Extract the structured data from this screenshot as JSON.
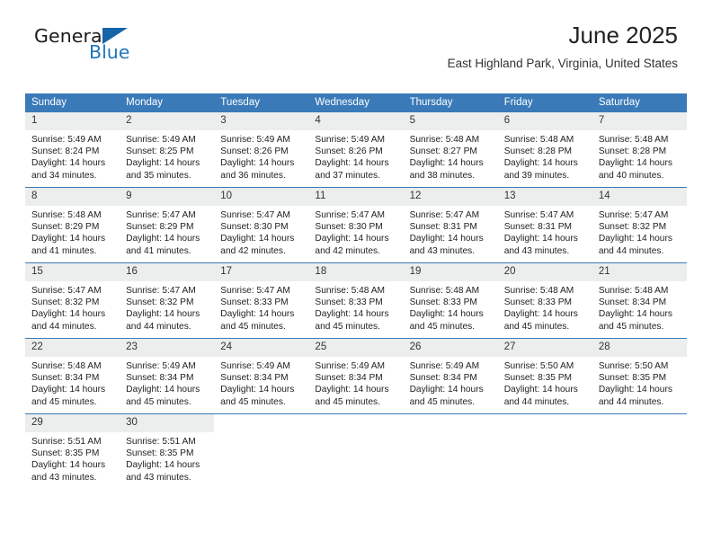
{
  "brand": {
    "word_one": "General",
    "word_two": "Blue",
    "flag_icon": "triangle-flag-icon",
    "blue_hex": "#1f77bd",
    "dark_blue_hex": "#1565a8"
  },
  "header": {
    "title": "June 2025",
    "location": "East Highland Park, Virginia, United States"
  },
  "calendar": {
    "header_bg_hex": "#3a7ab8",
    "daynum_bg_hex": "#eceded",
    "weekdays": [
      "Sunday",
      "Monday",
      "Tuesday",
      "Wednesday",
      "Thursday",
      "Friday",
      "Saturday"
    ],
    "weeks": [
      [
        {
          "day": "1",
          "sunrise": "Sunrise: 5:49 AM",
          "sunset": "Sunset: 8:24 PM",
          "daylight_line1": "Daylight: 14 hours",
          "daylight_line2": "and 34 minutes."
        },
        {
          "day": "2",
          "sunrise": "Sunrise: 5:49 AM",
          "sunset": "Sunset: 8:25 PM",
          "daylight_line1": "Daylight: 14 hours",
          "daylight_line2": "and 35 minutes."
        },
        {
          "day": "3",
          "sunrise": "Sunrise: 5:49 AM",
          "sunset": "Sunset: 8:26 PM",
          "daylight_line1": "Daylight: 14 hours",
          "daylight_line2": "and 36 minutes."
        },
        {
          "day": "4",
          "sunrise": "Sunrise: 5:49 AM",
          "sunset": "Sunset: 8:26 PM",
          "daylight_line1": "Daylight: 14 hours",
          "daylight_line2": "and 37 minutes."
        },
        {
          "day": "5",
          "sunrise": "Sunrise: 5:48 AM",
          "sunset": "Sunset: 8:27 PM",
          "daylight_line1": "Daylight: 14 hours",
          "daylight_line2": "and 38 minutes."
        },
        {
          "day": "6",
          "sunrise": "Sunrise: 5:48 AM",
          "sunset": "Sunset: 8:28 PM",
          "daylight_line1": "Daylight: 14 hours",
          "daylight_line2": "and 39 minutes."
        },
        {
          "day": "7",
          "sunrise": "Sunrise: 5:48 AM",
          "sunset": "Sunset: 8:28 PM",
          "daylight_line1": "Daylight: 14 hours",
          "daylight_line2": "and 40 minutes."
        }
      ],
      [
        {
          "day": "8",
          "sunrise": "Sunrise: 5:48 AM",
          "sunset": "Sunset: 8:29 PM",
          "daylight_line1": "Daylight: 14 hours",
          "daylight_line2": "and 41 minutes."
        },
        {
          "day": "9",
          "sunrise": "Sunrise: 5:47 AM",
          "sunset": "Sunset: 8:29 PM",
          "daylight_line1": "Daylight: 14 hours",
          "daylight_line2": "and 41 minutes."
        },
        {
          "day": "10",
          "sunrise": "Sunrise: 5:47 AM",
          "sunset": "Sunset: 8:30 PM",
          "daylight_line1": "Daylight: 14 hours",
          "daylight_line2": "and 42 minutes."
        },
        {
          "day": "11",
          "sunrise": "Sunrise: 5:47 AM",
          "sunset": "Sunset: 8:30 PM",
          "daylight_line1": "Daylight: 14 hours",
          "daylight_line2": "and 42 minutes."
        },
        {
          "day": "12",
          "sunrise": "Sunrise: 5:47 AM",
          "sunset": "Sunset: 8:31 PM",
          "daylight_line1": "Daylight: 14 hours",
          "daylight_line2": "and 43 minutes."
        },
        {
          "day": "13",
          "sunrise": "Sunrise: 5:47 AM",
          "sunset": "Sunset: 8:31 PM",
          "daylight_line1": "Daylight: 14 hours",
          "daylight_line2": "and 43 minutes."
        },
        {
          "day": "14",
          "sunrise": "Sunrise: 5:47 AM",
          "sunset": "Sunset: 8:32 PM",
          "daylight_line1": "Daylight: 14 hours",
          "daylight_line2": "and 44 minutes."
        }
      ],
      [
        {
          "day": "15",
          "sunrise": "Sunrise: 5:47 AM",
          "sunset": "Sunset: 8:32 PM",
          "daylight_line1": "Daylight: 14 hours",
          "daylight_line2": "and 44 minutes."
        },
        {
          "day": "16",
          "sunrise": "Sunrise: 5:47 AM",
          "sunset": "Sunset: 8:32 PM",
          "daylight_line1": "Daylight: 14 hours",
          "daylight_line2": "and 44 minutes."
        },
        {
          "day": "17",
          "sunrise": "Sunrise: 5:47 AM",
          "sunset": "Sunset: 8:33 PM",
          "daylight_line1": "Daylight: 14 hours",
          "daylight_line2": "and 45 minutes."
        },
        {
          "day": "18",
          "sunrise": "Sunrise: 5:48 AM",
          "sunset": "Sunset: 8:33 PM",
          "daylight_line1": "Daylight: 14 hours",
          "daylight_line2": "and 45 minutes."
        },
        {
          "day": "19",
          "sunrise": "Sunrise: 5:48 AM",
          "sunset": "Sunset: 8:33 PM",
          "daylight_line1": "Daylight: 14 hours",
          "daylight_line2": "and 45 minutes."
        },
        {
          "day": "20",
          "sunrise": "Sunrise: 5:48 AM",
          "sunset": "Sunset: 8:33 PM",
          "daylight_line1": "Daylight: 14 hours",
          "daylight_line2": "and 45 minutes."
        },
        {
          "day": "21",
          "sunrise": "Sunrise: 5:48 AM",
          "sunset": "Sunset: 8:34 PM",
          "daylight_line1": "Daylight: 14 hours",
          "daylight_line2": "and 45 minutes."
        }
      ],
      [
        {
          "day": "22",
          "sunrise": "Sunrise: 5:48 AM",
          "sunset": "Sunset: 8:34 PM",
          "daylight_line1": "Daylight: 14 hours",
          "daylight_line2": "and 45 minutes."
        },
        {
          "day": "23",
          "sunrise": "Sunrise: 5:49 AM",
          "sunset": "Sunset: 8:34 PM",
          "daylight_line1": "Daylight: 14 hours",
          "daylight_line2": "and 45 minutes."
        },
        {
          "day": "24",
          "sunrise": "Sunrise: 5:49 AM",
          "sunset": "Sunset: 8:34 PM",
          "daylight_line1": "Daylight: 14 hours",
          "daylight_line2": "and 45 minutes."
        },
        {
          "day": "25",
          "sunrise": "Sunrise: 5:49 AM",
          "sunset": "Sunset: 8:34 PM",
          "daylight_line1": "Daylight: 14 hours",
          "daylight_line2": "and 45 minutes."
        },
        {
          "day": "26",
          "sunrise": "Sunrise: 5:49 AM",
          "sunset": "Sunset: 8:34 PM",
          "daylight_line1": "Daylight: 14 hours",
          "daylight_line2": "and 45 minutes."
        },
        {
          "day": "27",
          "sunrise": "Sunrise: 5:50 AM",
          "sunset": "Sunset: 8:35 PM",
          "daylight_line1": "Daylight: 14 hours",
          "daylight_line2": "and 44 minutes."
        },
        {
          "day": "28",
          "sunrise": "Sunrise: 5:50 AM",
          "sunset": "Sunset: 8:35 PM",
          "daylight_line1": "Daylight: 14 hours",
          "daylight_line2": "and 44 minutes."
        }
      ],
      [
        {
          "day": "29",
          "sunrise": "Sunrise: 5:51 AM",
          "sunset": "Sunset: 8:35 PM",
          "daylight_line1": "Daylight: 14 hours",
          "daylight_line2": "and 43 minutes."
        },
        {
          "day": "30",
          "sunrise": "Sunrise: 5:51 AM",
          "sunset": "Sunset: 8:35 PM",
          "daylight_line1": "Daylight: 14 hours",
          "daylight_line2": "and 43 minutes."
        },
        {
          "day": "",
          "sunrise": "",
          "sunset": "",
          "daylight_line1": "",
          "daylight_line2": ""
        },
        {
          "day": "",
          "sunrise": "",
          "sunset": "",
          "daylight_line1": "",
          "daylight_line2": ""
        },
        {
          "day": "",
          "sunrise": "",
          "sunset": "",
          "daylight_line1": "",
          "daylight_line2": ""
        },
        {
          "day": "",
          "sunrise": "",
          "sunset": "",
          "daylight_line1": "",
          "daylight_line2": ""
        },
        {
          "day": "",
          "sunrise": "",
          "sunset": "",
          "daylight_line1": "",
          "daylight_line2": ""
        }
      ]
    ]
  }
}
